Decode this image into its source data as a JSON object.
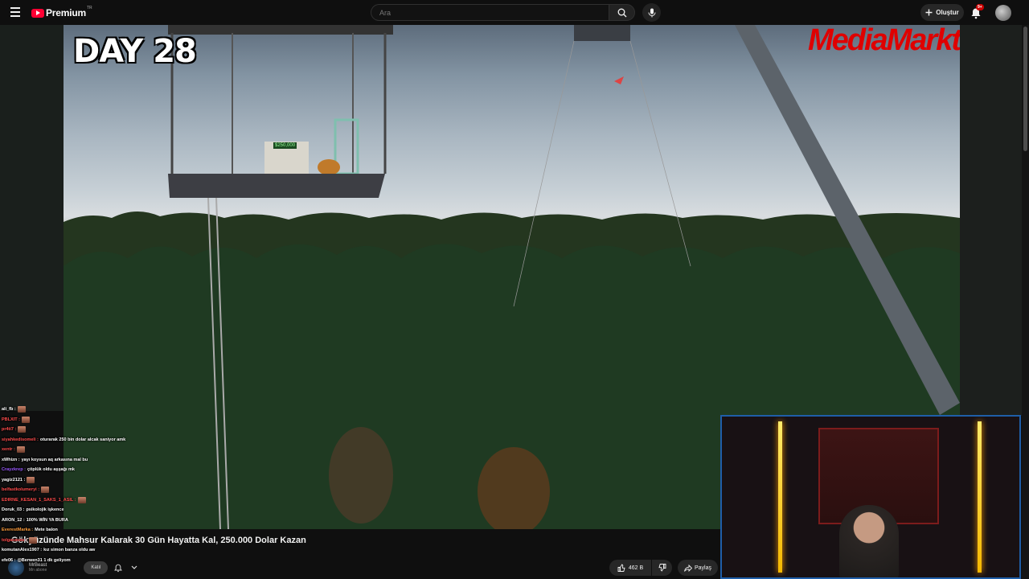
{
  "header": {
    "logo_text": "Premium",
    "logo_sup": "TR",
    "search_placeholder": "Ara",
    "create_label": "Oluştur",
    "notification_count": "9+"
  },
  "video": {
    "overlay_day": "DAY 28",
    "brand_watermark": "MediaMarkt",
    "price_tag": "$250,000",
    "title": "Gökyüzünde Mahsur Kalarak 30 Gün Hayatta Kal, 250.000 Dolar Kazan"
  },
  "channel": {
    "name": "MrBeast",
    "subscribers": "Mn abone",
    "join_label": "Katıl"
  },
  "actions": {
    "like_count": "462 B",
    "share_label": "Paylaş"
  },
  "chat": [
    {
      "user": "ali_fb :",
      "text": "",
      "color": "#ffffff",
      "emote": true
    },
    {
      "user": "PBLXIT :",
      "text": "",
      "color": "#ff4c4c",
      "emote": true
    },
    {
      "user": "pr4ti7 :",
      "text": "",
      "color": "#ff4c4c",
      "emote": true
    },
    {
      "user": "siyahkedisomeli :",
      "text": "oturarak 250 bin dolar alcak saniyor amk",
      "color": "#ff4c4c",
      "emote": false
    },
    {
      "user": "xentr :",
      "text": "",
      "color": "#ff4c4c",
      "emote": true
    },
    {
      "user": "xWhizn :",
      "text": "yayı koysun aq arkasına mal bu",
      "color": "#ffffff",
      "emote": false
    },
    {
      "user": "Crayzkrep :",
      "text": "çöplük oldu aşşağı mk",
      "color": "#9b59ff",
      "emote": false
    },
    {
      "user": "yagiz2121 :",
      "text": "",
      "color": "#ffffff",
      "emote": true
    },
    {
      "user": "belfastkolumeryi :",
      "text": "",
      "color": "#ff4c4c",
      "emote": true
    },
    {
      "user": "EDIRNE_KESAN_1_SAKS_1_ASIL :",
      "text": "",
      "color": "#ff4c4c",
      "emote": true
    },
    {
      "user": "Doruk_03 :",
      "text": "psikolojik işkence",
      "color": "#ffffff",
      "emote": false
    },
    {
      "user": "ARON_12 :",
      "text": "100% WİN YA BURA",
      "color": "#ffffff",
      "emote": false
    },
    {
      "user": "EverestMarka :",
      "text": "Mete balon",
      "color": "#ff9d3c",
      "emote": false
    },
    {
      "user": "tolgasavas :",
      "text": "",
      "color": "#ff4c4c",
      "emote": true
    },
    {
      "user": "komutanAlex1907 :",
      "text": "kız simon banza oldu aw",
      "color": "#ffffff",
      "emote": false
    },
    {
      "user": "efe06 :",
      "text": "@Berwen31 1 dk geliyom",
      "color": "#ffffff",
      "emote": false
    }
  ],
  "colors": {
    "background": "#0f0f0f",
    "accent_red": "#ff0033",
    "webcam_border": "#1f5ea8",
    "neon": "#f5b800"
  },
  "icons": [
    "menu-icon",
    "search-icon",
    "mic-icon",
    "plus-icon",
    "bell-icon",
    "thumbs-up-icon",
    "thumbs-down-icon",
    "share-icon",
    "chevron-down-icon"
  ]
}
